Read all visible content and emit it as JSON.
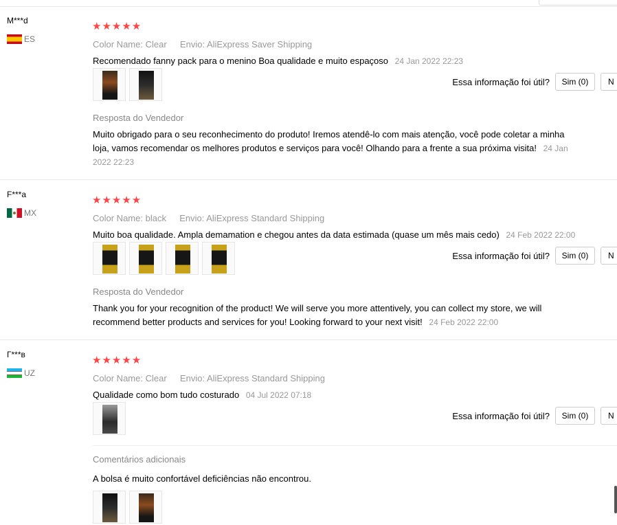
{
  "reviews": [
    {
      "user": "M***d",
      "country_code": "ES",
      "stars": "★★★★★",
      "color_label": "Color Name:",
      "color_value": "Clear",
      "ship_label": "Envio:",
      "ship_value": "AliExpress Saver Shipping",
      "text": "Recomendado fanny pack para o menino Boa qualidade e muito espaçoso",
      "date": "24 Jan 2022 22:23",
      "helpful_label": "Essa informação foi útil?",
      "yes_label": "Sim (0)",
      "no_label": "N",
      "reply_title": "Resposta do Vendedor",
      "reply_text": "Muito obrigado para o seu reconhecimento do produto! Iremos atendê-lo com mais atenção, você pode coletar a minha loja, vamos recomendar os melhores produtos e serviços para você! Olhando para a frente a sua próxima visita!",
      "reply_date": "24 Jan 2022 22:23"
    },
    {
      "user": "F***a",
      "country_code": "MX",
      "stars": "★★★★★",
      "color_label": "Color Name:",
      "color_value": "black",
      "ship_label": "Envio:",
      "ship_value": "AliExpress Standard Shipping",
      "text": "Muito boa qualidade. Ampla demamation e chegou antes da data estimada (quase um mês mais cedo)",
      "date": "24 Feb 2022 22:00",
      "helpful_label": "Essa informação foi útil?",
      "yes_label": "Sim (0)",
      "no_label": "N",
      "reply_title": "Resposta do Vendedor",
      "reply_text": "Thank you for your recognition of the product! We will serve you more attentively, you can collect my store, we will recommend better products and services for you! Looking forward to your next visit!",
      "reply_date": "24 Feb 2022 22:00"
    },
    {
      "user": "Г***в",
      "country_code": "UZ",
      "stars": "★★★★★",
      "color_label": "Color Name:",
      "color_value": "Clear",
      "ship_label": "Envio:",
      "ship_value": "AliExpress Standard Shipping",
      "text": "Qualidade como bom tudo costurado",
      "date": "04 Jul 2022 07:18",
      "helpful_label": "Essa informação foi útil?",
      "yes_label": "Sim (0)",
      "no_label": "N",
      "additional_title": "Comentários adicionais",
      "additional_text": "A bolsa é muito confortável deficiências não encontrou."
    }
  ]
}
